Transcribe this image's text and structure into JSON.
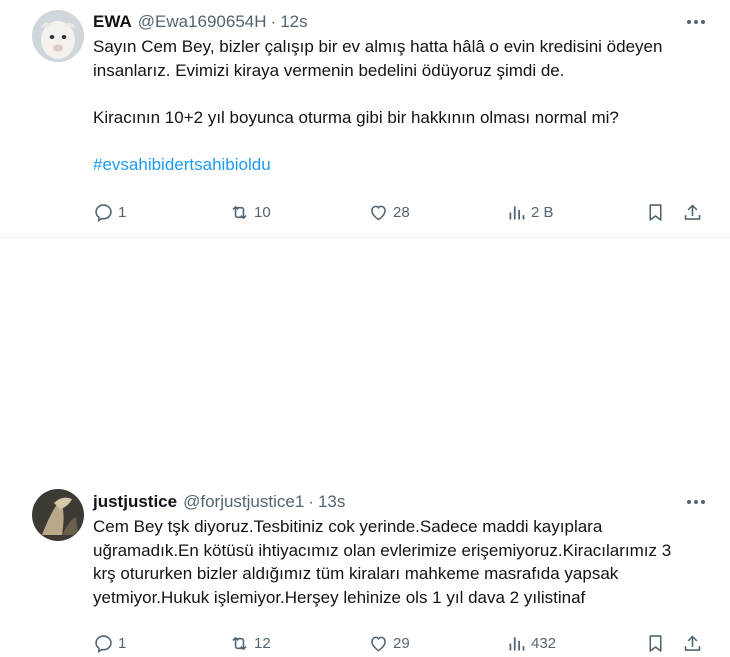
{
  "tweets": [
    {
      "name": "EWA",
      "handle": "@Ewa1690654H",
      "time": "12s",
      "lines": [
        "Sayın Cem Bey, bizler çalışıp bir ev almış hatta hâlâ o evin kredisini ödeyen",
        "insanlarız. Evimizi kiraya vermenin bedelini ödüyoruz şimdi de.",
        "",
        "Kiracının 10+2 yıl boyunca oturma gibi bir hakkının olması normal mi?",
        ""
      ],
      "hashtag": "#evsahibidertsahibioldu",
      "replies": "1",
      "retweets": "10",
      "likes": "28",
      "views": "2 B"
    },
    {
      "name": "justjustice",
      "handle": "@forjustjustice1",
      "time": "13s",
      "lines": [
        "Cem Bey tşk diyoruz.Tesbitiniz cok yerinde.Sadece maddi kayıplara",
        "uğramadık.En kötüsü ihtiyacımız olan evlerimize erişemiyoruz.Kiracılarımız 3",
        "krş otururken bizler aldığımız tüm kiraları mahkeme masrafıda yapsak",
        "yetmiyor.Hukuk işlemiyor.Herşey lehinize ols 1 yıl dava 2 yılistinaf"
      ],
      "replies": "1",
      "retweets": "12",
      "likes": "29",
      "views": "432"
    }
  ],
  "colors": {
    "text": "#0f1419",
    "muted": "#536471",
    "link": "#1d9bf0",
    "divider": "#eff3f4"
  },
  "icons": [
    "more-icon",
    "reply-icon",
    "retweet-icon",
    "like-icon",
    "views-icon",
    "bookmark-icon",
    "share-icon"
  ]
}
